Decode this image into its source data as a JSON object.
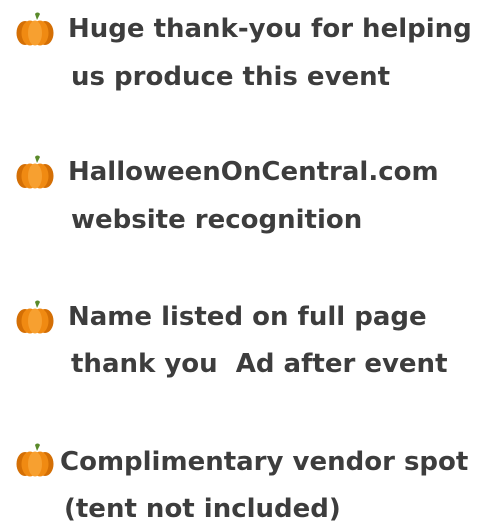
{
  "benefits": [
    {
      "icon": "pumpkin-icon",
      "line1": "Huge thank-you for helping",
      "line2": "us produce this event"
    },
    {
      "icon": "pumpkin-icon",
      "line1": "HalloweenOnCentral.com",
      "line2": "website recognition"
    },
    {
      "icon": "pumpkin-icon",
      "line1": "Name listed on full page",
      "line2": "thank you  Ad after event"
    },
    {
      "icon": "pumpkin-icon",
      "line1": "Complimentary vendor spot",
      "line2": "(tent not included)"
    }
  ],
  "colors": {
    "text": "#3d3d3d",
    "pumpkin": "#f08a12",
    "pumpkin_dark": "#d46f05",
    "stem": "#5a8a2a"
  }
}
